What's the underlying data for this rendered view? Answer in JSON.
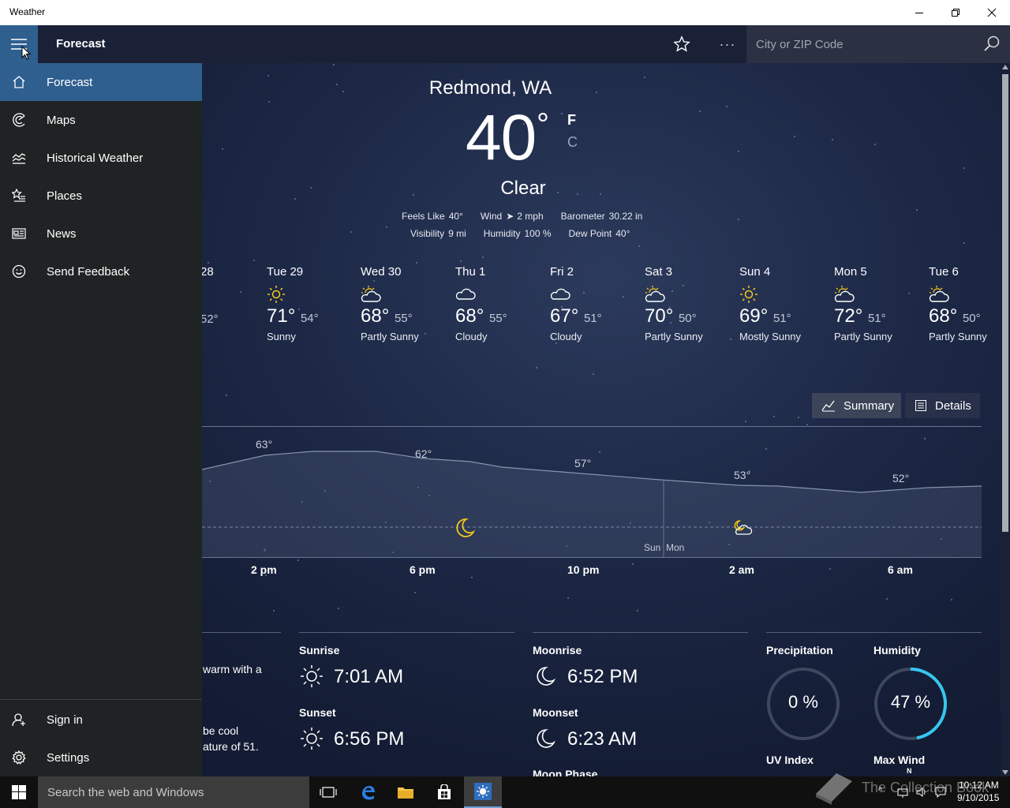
{
  "window": {
    "title": "Weather"
  },
  "header": {
    "title": "Forecast",
    "search_placeholder": "City or ZIP Code"
  },
  "nav": {
    "items": [
      {
        "label": "Forecast",
        "icon": "home-icon",
        "active": true
      },
      {
        "label": "Maps",
        "icon": "radar-icon"
      },
      {
        "label": "Historical Weather",
        "icon": "chart-icon"
      },
      {
        "label": "Places",
        "icon": "star-list-icon"
      },
      {
        "label": "News",
        "icon": "news-icon"
      },
      {
        "label": "Send Feedback",
        "icon": "smiley-icon"
      }
    ],
    "bottom": [
      {
        "label": "Sign in",
        "icon": "person-icon"
      },
      {
        "label": "Settings",
        "icon": "gear-icon"
      }
    ]
  },
  "current": {
    "location": "Redmond, WA",
    "temperature": "40",
    "degree": "°",
    "unit_f": "F",
    "unit_c": "C",
    "condition": "Clear",
    "details_row1": [
      {
        "label": "Feels Like",
        "value": "40°"
      },
      {
        "label": "Wind",
        "value": "2 mph"
      },
      {
        "label": "Barometer",
        "value": "30.22 in"
      }
    ],
    "details_row2": [
      {
        "label": "Visibility",
        "value": "9 mi"
      },
      {
        "label": "Humidity",
        "value": "100 %"
      },
      {
        "label": "Dew Point",
        "value": "40°"
      }
    ]
  },
  "daily": [
    {
      "day": "28",
      "hi": "",
      "lo": "52°",
      "cond": "",
      "icon": ""
    },
    {
      "day": "Tue 29",
      "hi": "71°",
      "lo": "54°",
      "cond": "Sunny",
      "icon": "sun-icon"
    },
    {
      "day": "Wed 30",
      "hi": "68°",
      "lo": "55°",
      "cond": "Partly Sunny",
      "icon": "partly-sunny-icon"
    },
    {
      "day": "Thu 1",
      "hi": "68°",
      "lo": "55°",
      "cond": "Cloudy",
      "icon": "cloud-icon"
    },
    {
      "day": "Fri 2",
      "hi": "67°",
      "lo": "51°",
      "cond": "Cloudy",
      "icon": "cloud-icon"
    },
    {
      "day": "Sat 3",
      "hi": "70°",
      "lo": "50°",
      "cond": "Partly Sunny",
      "icon": "partly-sunny-icon"
    },
    {
      "day": "Sun 4",
      "hi": "69°",
      "lo": "51°",
      "cond": "Mostly Sunny",
      "icon": "sun-icon"
    },
    {
      "day": "Mon 5",
      "hi": "72°",
      "lo": "51°",
      "cond": "Partly Sunny",
      "icon": "partly-sunny-icon"
    },
    {
      "day": "Tue 6",
      "hi": "68°",
      "lo": "50°",
      "cond": "Partly Sunny",
      "icon": "partly-sunny-icon"
    }
  ],
  "view_toggle": {
    "summary": "Summary",
    "details": "Details"
  },
  "hourly": {
    "temps": [
      "63°",
      "62°",
      "57°",
      "53°",
      "52°"
    ],
    "times": [
      "2 pm",
      "6 pm",
      "10 pm",
      "2 am",
      "6 am"
    ],
    "day_divider": {
      "before": "Sun",
      "after": "Mon"
    }
  },
  "sections": {
    "summary_text_1": "warm with a",
    "summary_text_2": "be cool",
    "summary_text_3": "ature of 51.",
    "sunrise_label": "Sunrise",
    "sunrise": "7:01 AM",
    "sunset_label": "Sunset",
    "sunset": "6:56 PM",
    "moonrise_label": "Moonrise",
    "moonrise": "6:52 PM",
    "moonset_label": "Moonset",
    "moonset": "6:23 AM",
    "moonphase_label": "Moon Phase",
    "precip_label": "Precipitation",
    "precip": "0 %",
    "precip_fraction": 0,
    "humidity_label": "Humidity",
    "humidity": "47 %",
    "humidity_fraction": 0.47,
    "uv_label": "UV Index",
    "maxwind_label": "Max Wind",
    "compass_n": "N"
  },
  "taskbar": {
    "search_placeholder": "Search the web and Windows",
    "time": "10:12 AM",
    "date": "9/10/2015",
    "watermark": "The Collection Book"
  },
  "colors": {
    "accent": "#2f5f8f",
    "nav_bg": "#1f2323",
    "ring": "#35c6f0",
    "sun": "#f2c81b"
  }
}
